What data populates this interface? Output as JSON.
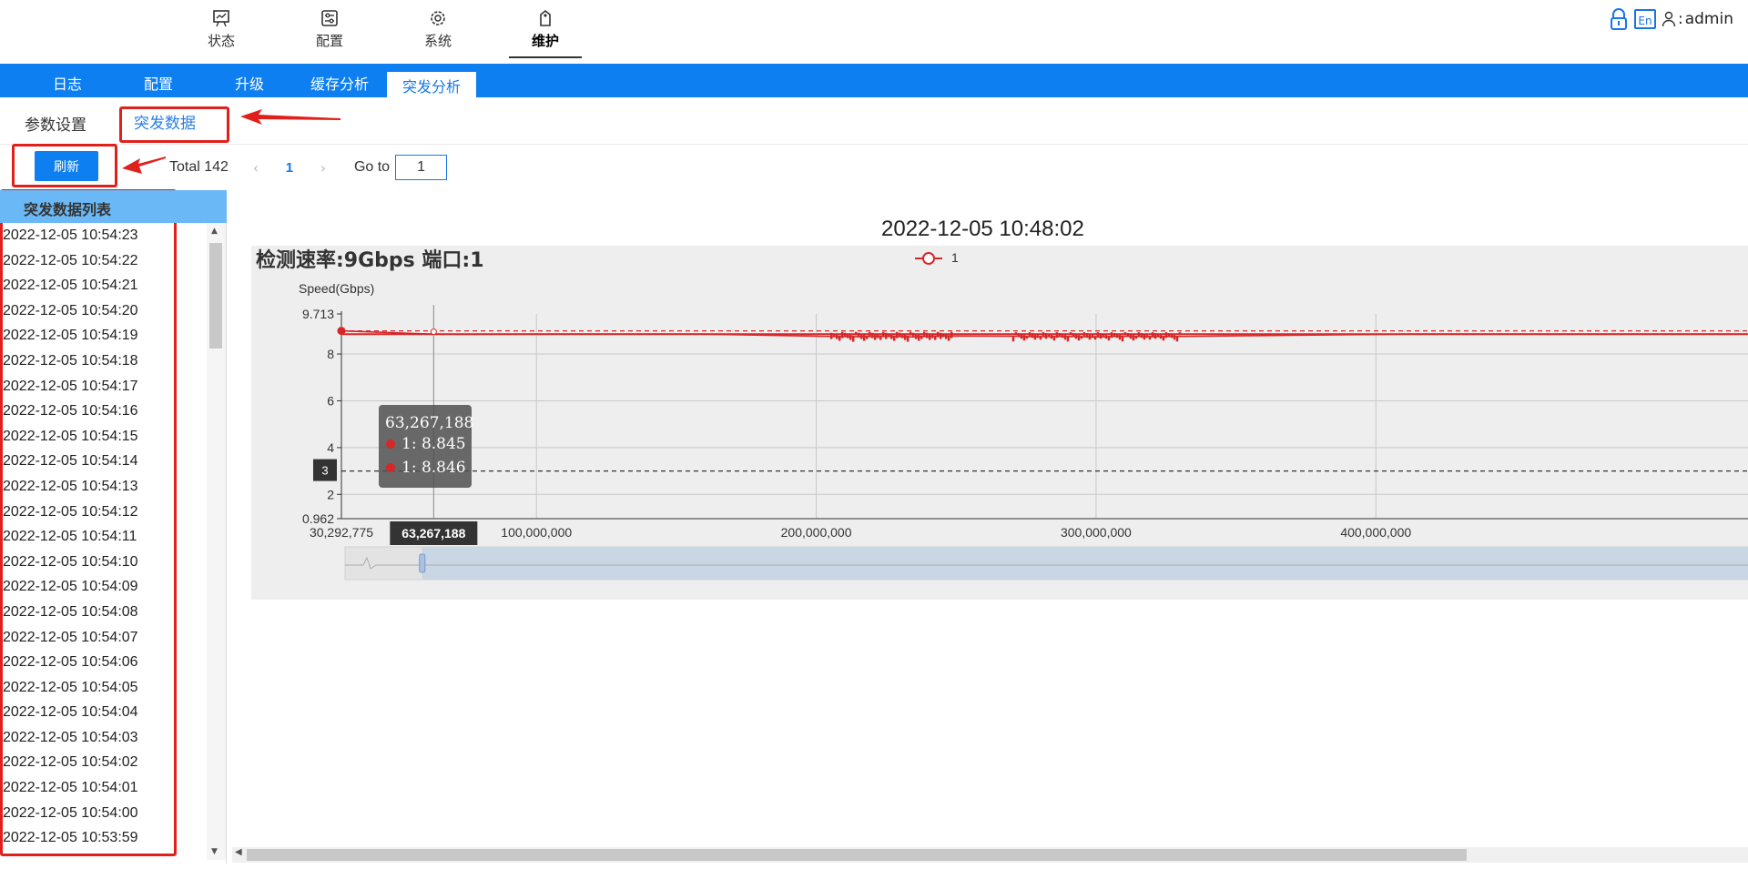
{
  "topnav": {
    "items": [
      {
        "label": "状态",
        "icon": "status-board-icon"
      },
      {
        "label": "配置",
        "icon": "config-sliders-icon"
      },
      {
        "label": "系统",
        "icon": "system-gear-icon"
      },
      {
        "label": "维护",
        "icon": "maintenance-tag-icon"
      }
    ],
    "active": "维护",
    "lang_badge": "En",
    "user": "admin"
  },
  "tabs": [
    "日志",
    "配置",
    "升级",
    "缓存分析",
    "突发分析"
  ],
  "active_tab": "突发分析",
  "subtabs": [
    "参数设置",
    "突发数据"
  ],
  "active_subtab": "突发数据",
  "toolbar": {
    "refresh_label": "刷新",
    "total_label": "Total 142",
    "current_page": "1",
    "goto_label": "Go to",
    "goto_value": "1"
  },
  "list": {
    "header": "突发数据列表",
    "items": [
      "2022-12-05 10:54:23",
      "2022-12-05 10:54:22",
      "2022-12-05 10:54:21",
      "2022-12-05 10:54:20",
      "2022-12-05 10:54:19",
      "2022-12-05 10:54:18",
      "2022-12-05 10:54:17",
      "2022-12-05 10:54:16",
      "2022-12-05 10:54:15",
      "2022-12-05 10:54:14",
      "2022-12-05 10:54:13",
      "2022-12-05 10:54:12",
      "2022-12-05 10:54:11",
      "2022-12-05 10:54:10",
      "2022-12-05 10:54:09",
      "2022-12-05 10:54:08",
      "2022-12-05 10:54:07",
      "2022-12-05 10:54:06",
      "2022-12-05 10:54:05",
      "2022-12-05 10:54:04",
      "2022-12-05 10:54:03",
      "2022-12-05 10:54:02",
      "2022-12-05 10:54:01",
      "2022-12-05 10:54:00",
      "2022-12-05 10:53:59"
    ]
  },
  "chart_data": {
    "type": "line",
    "title": "2022-12-05 10:48:02",
    "subtitle": "检测速率:9Gbps  端口:1",
    "ylabel": "Speed(Gbps)",
    "xlabel": "",
    "legend": [
      "1"
    ],
    "legend_placement": "top-center",
    "series_color": "#d62728",
    "xlim": [
      30292775,
      533000000
    ],
    "ylim": [
      0.962,
      9.713
    ],
    "y_ticks": [
      0.962,
      2,
      4,
      6,
      8,
      9.713
    ],
    "y_tick_labels": [
      "0.962",
      "2",
      "4",
      "6",
      "8",
      "9.713"
    ],
    "x_ticks": [
      30292775,
      100000000,
      200000000,
      300000000,
      400000000
    ],
    "x_tick_labels": [
      "30,292,775",
      "100,000,000",
      "200,000,000",
      "300,000,000",
      "400,000,000"
    ],
    "markline_y": 3,
    "markline_label": "3",
    "max_line_y": 8.99,
    "series": [
      {
        "name": "1",
        "baseline": 8.85,
        "x": [
          30292775,
          63267188,
          160000000,
          205000000,
          215000000,
          225000000,
          235000000,
          245000000,
          270000000,
          280000000,
          290000000,
          300000000,
          310000000,
          320000000,
          330000000,
          410000000,
          533000000
        ],
        "y": [
          8.99,
          8.846,
          8.85,
          8.75,
          8.74,
          8.76,
          8.73,
          8.77,
          8.76,
          8.74,
          8.75,
          8.73,
          8.76,
          8.74,
          8.75,
          8.85,
          8.85
        ]
      }
    ],
    "grid": true,
    "tooltip": {
      "title": "63,267,188",
      "rows": [
        "1: 8.845",
        "1: 8.846"
      ]
    },
    "axis_pointer_label": "63,267,188",
    "data_zoom": {
      "start_fraction": 0.0,
      "end_fraction": 0.055
    }
  }
}
